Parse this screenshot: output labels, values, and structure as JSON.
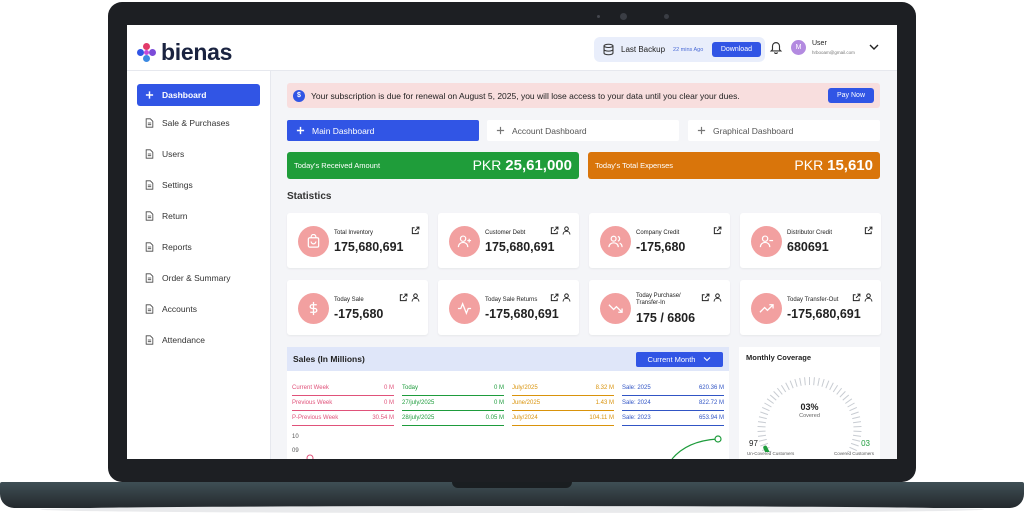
{
  "brand": {
    "name": "bienas"
  },
  "header": {
    "backup_label": "Last Backup",
    "backup_time": "22 mins Ago",
    "download_label": "Download",
    "avatar_initial": "M",
    "user_name": "User",
    "user_email": "hrbooam@gmail.com"
  },
  "sidebar": {
    "items": [
      {
        "label": "Dashboard",
        "icon": "plus-icon",
        "active": true
      },
      {
        "label": "Sale & Purchases",
        "icon": "document-icon"
      },
      {
        "label": "Users",
        "icon": "document-icon"
      },
      {
        "label": "Settings",
        "icon": "document-icon"
      },
      {
        "label": "Return",
        "icon": "document-icon"
      },
      {
        "label": "Reports",
        "icon": "document-icon"
      },
      {
        "label": "Order & Summary",
        "icon": "document-icon"
      },
      {
        "label": "Accounts",
        "icon": "document-icon"
      },
      {
        "label": "Attendance",
        "icon": "document-icon"
      }
    ]
  },
  "banner": {
    "text": "Your subscription is due for renewal on August 5, 2025, you will lose access to your data until you clear your dues.",
    "pay_label": "Pay Now"
  },
  "tabs": [
    {
      "label": "Main Dashboard",
      "active": true
    },
    {
      "label": "Account Dashboard"
    },
    {
      "label": "Graphical Dashboard"
    }
  ],
  "kpis": [
    {
      "label": "Today's Received Amount",
      "currency": "PKR",
      "value": "25,61,000",
      "color": "#1f9d3a"
    },
    {
      "label": "Today's Total Expenses",
      "currency": "PKR",
      "value": "15,610",
      "color": "#d9750b"
    }
  ],
  "statistics": {
    "title": "Statistics",
    "cards": [
      {
        "label": "Total Inventory",
        "value": "175,680,691",
        "icon": "bag-icon"
      },
      {
        "label": "Customer Debt",
        "value": "175,680,691",
        "icon": "user-plus-icon"
      },
      {
        "label": "Company Credit",
        "value": "-175,680",
        "icon": "users-icon"
      },
      {
        "label": "Distributor Credit",
        "value": "680691",
        "icon": "user-minus-icon"
      },
      {
        "label": "Today Sale",
        "value": "-175,680",
        "icon": "dollar-icon"
      },
      {
        "label": "Today Sale Returns",
        "value": "-175,680,691",
        "icon": "pulse-icon"
      },
      {
        "label": "Today Purchase/ Transfer-In",
        "value": "175 / 6806",
        "icon": "trend-down-icon"
      },
      {
        "label": "Today Transfer-Out",
        "value": "-175,680,691",
        "icon": "trend-up-icon"
      }
    ]
  },
  "sales": {
    "title": "Sales (In Millions)",
    "period_label": "Current Month",
    "columns": [
      {
        "color": "#e0527a",
        "rows": [
          {
            "label": "Current Week",
            "value": "0 M"
          },
          {
            "label": "Previous Week",
            "value": "0 M"
          },
          {
            "label": "P-Previous Week",
            "value": "30.54 M"
          }
        ]
      },
      {
        "color": "#1e9c3c",
        "rows": [
          {
            "label": "Today",
            "value": "0 M"
          },
          {
            "label": "27/july/2025",
            "value": "0 M"
          },
          {
            "label": "28/july/2025",
            "value": "0.05 M"
          }
        ]
      },
      {
        "color": "#d9930b",
        "rows": [
          {
            "label": "July/2025",
            "value": "8.32 M"
          },
          {
            "label": "June/2025",
            "value": "1.43 M"
          },
          {
            "label": "July/2024",
            "value": "104.11 M"
          }
        ]
      },
      {
        "color": "#3155c5",
        "rows": [
          {
            "label": "Sale: 2025",
            "value": "620.36 M"
          },
          {
            "label": "Sale: 2024",
            "value": "822.72 M"
          },
          {
            "label": "Sale: 2023",
            "value": "653.94 M"
          }
        ]
      }
    ],
    "chart_ticks": [
      "10",
      "09"
    ]
  },
  "coverage": {
    "title": "Monthly Coverage",
    "percent": "03%",
    "percent_value": 3,
    "sub_label": "Covered",
    "uncovered_count": "97",
    "covered_count": "03",
    "uncovered_label": "Un-Covered Customers",
    "covered_label": "Covered Customers"
  },
  "colors": {
    "accent": "#3155e5",
    "green": "#1f9d3a",
    "orange": "#d9750b",
    "pink": "#f2a0a0"
  }
}
